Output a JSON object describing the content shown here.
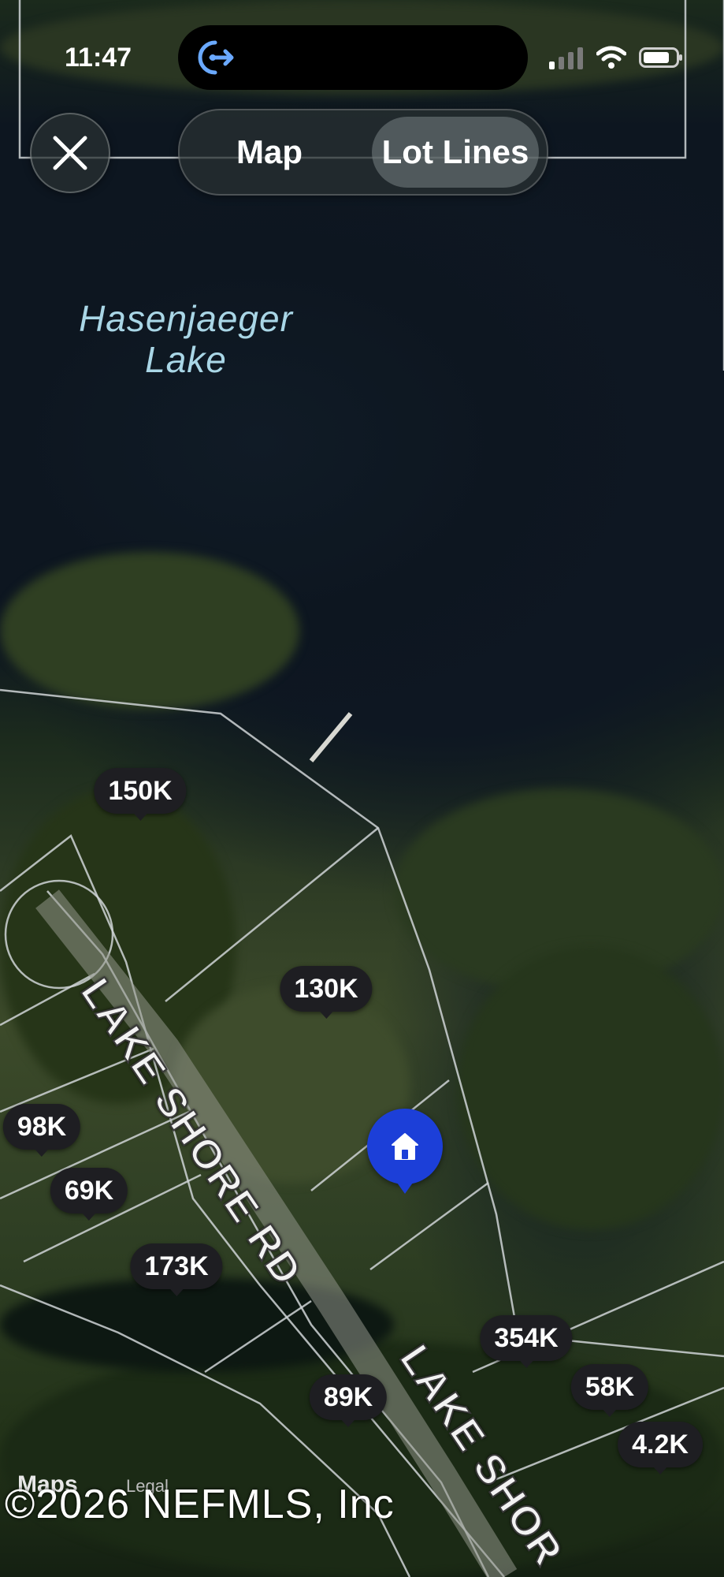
{
  "status_bar": {
    "time": "11:47",
    "icons": [
      "location-share-icon",
      "cellular-signal-icon",
      "wifi-icon",
      "battery-icon"
    ]
  },
  "toolbar": {
    "close_icon": "close-icon",
    "segments": [
      {
        "label": "Map",
        "active": false
      },
      {
        "label": "Lot Lines",
        "active": true
      }
    ]
  },
  "map": {
    "lake_name_line1": "Hasenjaeger",
    "lake_name_line2": "Lake",
    "roads": [
      "LAKE SHORE RD",
      "LAKE SHOR"
    ],
    "price_markers": [
      "150K",
      "130K",
      "98K",
      "69K",
      "173K",
      "354K",
      "58K",
      "4.2K",
      "89K"
    ],
    "home_pin_icon": "home-icon",
    "colors": {
      "home_pin": "#1c3fd8",
      "marker_bg": "#1e1e22",
      "lake_label": "#a9d6e6"
    }
  },
  "footer": {
    "maps_brand": "Maps",
    "legal": "Legal",
    "copyright": "©2026 NEFMLS, Inc"
  }
}
